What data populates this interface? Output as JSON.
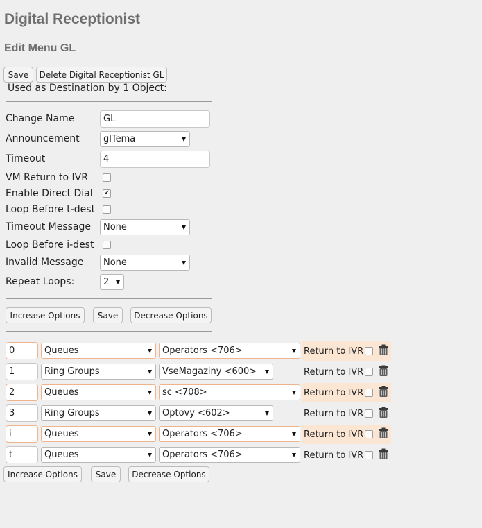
{
  "header": {
    "title": "Digital Receptionist",
    "subtitle": "Edit Menu GL"
  },
  "top_buttons": {
    "save": "Save",
    "delete": "Delete Digital Receptionist GL"
  },
  "used_as": "Used as Destination by 1 Object:",
  "form": {
    "change_name": {
      "label": "Change Name",
      "value": "GL"
    },
    "announcement": {
      "label": "Announcement",
      "value": "glTema"
    },
    "timeout": {
      "label": "Timeout",
      "value": "4"
    },
    "vm_return": {
      "label": "VM Return to IVR",
      "checked": false
    },
    "direct_dial": {
      "label": "Enable Direct Dial",
      "checked": true
    },
    "loop_t": {
      "label": "Loop Before t-dest",
      "checked": false
    },
    "timeout_message": {
      "label": "Timeout Message",
      "value": "None"
    },
    "loop_i": {
      "label": "Loop Before i-dest",
      "checked": false
    },
    "invalid_message": {
      "label": "Invalid Message",
      "value": "None"
    },
    "repeat_loops": {
      "label": "Repeat Loops:",
      "value": "2"
    }
  },
  "option_buttons": {
    "increase": "Increase Options",
    "save": "Save",
    "decrease": "Decrease Options"
  },
  "return_label": "Return to IVR",
  "entries": [
    {
      "digit": "0",
      "type": "Queues",
      "dest": "Operators <706>",
      "highlighted": true
    },
    {
      "digit": "1",
      "type": "Ring Groups",
      "dest": "VseMagaziny <600>",
      "highlighted": false
    },
    {
      "digit": "2",
      "type": "Queues",
      "dest": "sc <708>",
      "highlighted": true
    },
    {
      "digit": "3",
      "type": "Ring Groups",
      "dest": "Optovy <602>",
      "highlighted": false
    },
    {
      "digit": "i",
      "type": "Queues",
      "dest": "Operators <706>",
      "highlighted": true
    },
    {
      "digit": "t",
      "type": "Queues",
      "dest": "Operators <706>",
      "highlighted": false
    }
  ],
  "colors": {
    "title": "#6e6e6e",
    "row_highlight": "#fbe6d4",
    "highlight_border": "#f0b48c",
    "background": "#efefef"
  }
}
